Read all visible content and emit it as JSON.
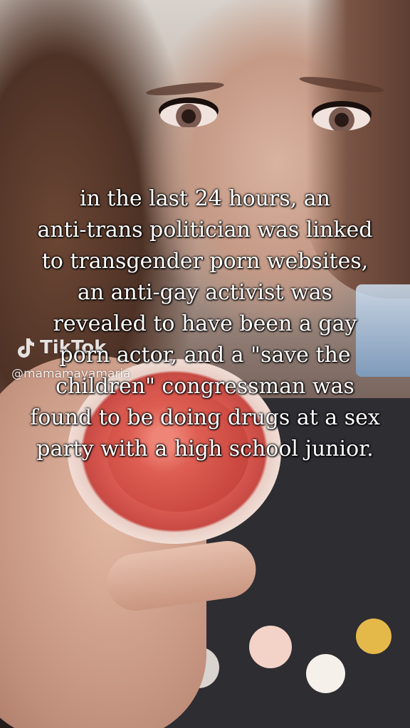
{
  "watermark": {
    "brand": "TikTok",
    "username": "@mamamayamaria"
  },
  "caption": {
    "lines": [
      "in the last 24 hours, an",
      "anti-trans politician was linked",
      "to transgender porn websites,",
      "an anti-gay activist was",
      "revealed to have been a gay",
      "porn actor, and a \"save the",
      "children\" congressman was",
      "found to be doing drugs at a sex",
      "party with a high school junior."
    ]
  },
  "colors": {
    "caption_text": "#ffffff",
    "caption_outline": "#000000",
    "makeup_powder": "#d85a50"
  },
  "icons": {
    "brand_icon": "tiktok-note-icon"
  }
}
